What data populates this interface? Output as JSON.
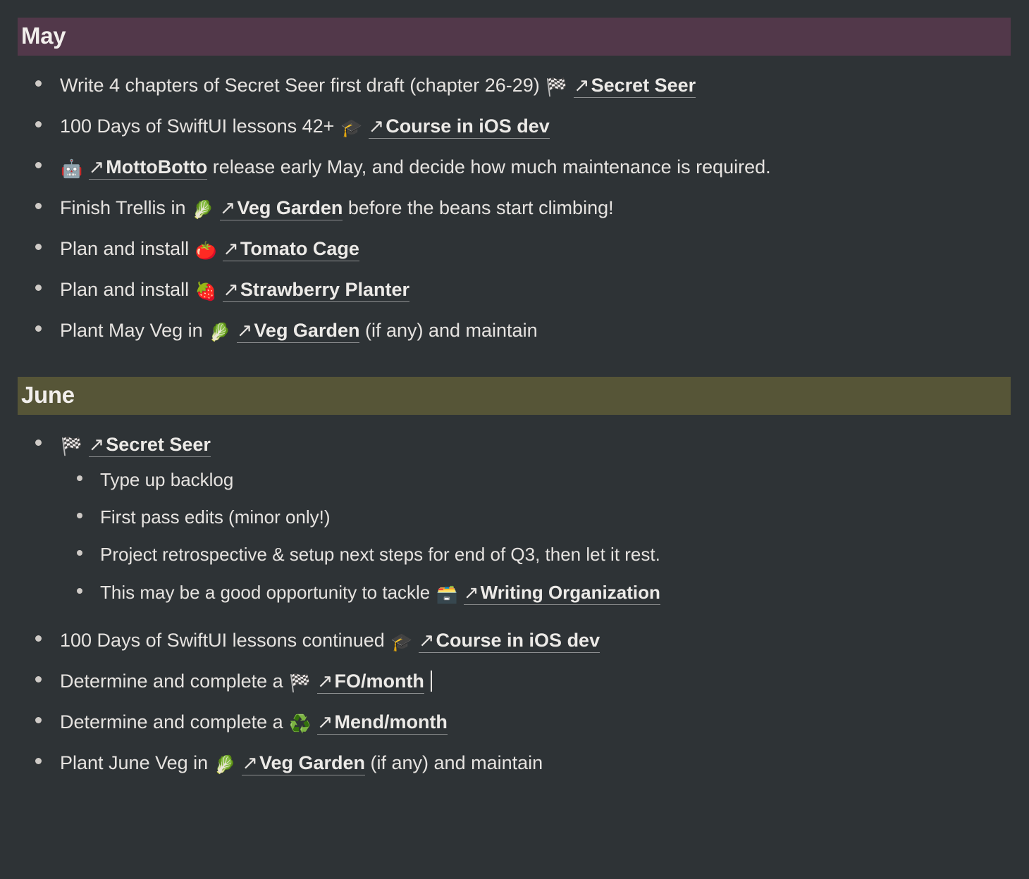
{
  "theme": {
    "background": "#2e3336",
    "text": "#e6e3e0",
    "link_underline": "#8d8f90",
    "may_header_bg": "#52384a",
    "june_header_bg": "#565537"
  },
  "icons": {
    "arrow_link": "↗",
    "checkered_flag": "🏁",
    "graduation_cap": "🎓",
    "robot": "🤖",
    "leafy_green": "🥬",
    "tomato": "🍅",
    "strawberry": "🍓",
    "card_file_box": "🗃️",
    "recycle": "♻️"
  },
  "sections": [
    {
      "id": "may",
      "title": "May",
      "items": [
        {
          "id": "may-secret-seer-chapters",
          "pre": "Write 4 chapters of Secret Seer first draft (chapter 26-29)",
          "emoji": "checkered_flag",
          "link": "Secret Seer",
          "post": ""
        },
        {
          "id": "may-swiftui-lessons",
          "pre": "100 Days of SwiftUI lessons 42+",
          "emoji": "graduation_cap",
          "link": "Course in iOS dev",
          "post": ""
        },
        {
          "id": "may-mottobotto",
          "pre": "",
          "emoji": "robot",
          "link": "MottoBotto",
          "post": "release early May, and decide how much maintenance is required."
        },
        {
          "id": "may-trellis",
          "pre": "Finish Trellis in",
          "emoji": "leafy_green",
          "link": "Veg Garden",
          "post": "before the beans start climbing!"
        },
        {
          "id": "may-tomato-cage",
          "pre": "Plan and install",
          "emoji": "tomato",
          "link": "Tomato Cage",
          "post": ""
        },
        {
          "id": "may-strawberry-planter",
          "pre": "Plan and install",
          "emoji": "strawberry",
          "link": "Strawberry Planter",
          "post": ""
        },
        {
          "id": "may-plant-veg",
          "pre": "Plant May Veg in",
          "emoji": "leafy_green",
          "link": "Veg Garden",
          "post": "(if any) and maintain"
        }
      ]
    },
    {
      "id": "june",
      "title": "June",
      "items": [
        {
          "id": "june-secret-seer",
          "pre": "",
          "emoji": "checkered_flag",
          "link": "Secret Seer",
          "post": "",
          "children": [
            {
              "id": "june-type-up-backlog",
              "pre": "Type up backlog",
              "emoji": "",
              "link": "",
              "post": ""
            },
            {
              "id": "june-first-pass-edits",
              "pre": "First pass edits (minor only!)",
              "emoji": "",
              "link": "",
              "post": ""
            },
            {
              "id": "june-retrospective",
              "pre": "Project retrospective & setup next steps for end of Q3, then let it rest.",
              "emoji": "",
              "link": "",
              "post": ""
            },
            {
              "id": "june-writing-organization",
              "pre": "This may be a good opportunity to tackle",
              "emoji": "card_file_box",
              "link": "Writing Organization",
              "post": ""
            }
          ]
        },
        {
          "id": "june-swiftui-lessons",
          "pre": "100 Days of SwiftUI lessons continued",
          "emoji": "graduation_cap",
          "link": "Course in iOS dev",
          "post": ""
        },
        {
          "id": "june-fo-month",
          "pre": "Determine and complete a",
          "emoji": "checkered_flag",
          "link": "FO/month",
          "post": "",
          "caret": true
        },
        {
          "id": "june-mend-month",
          "pre": "Determine and complete a",
          "emoji": "recycle",
          "link": "Mend/month",
          "post": ""
        },
        {
          "id": "june-plant-veg",
          "pre": "Plant June Veg in",
          "emoji": "leafy_green",
          "link": "Veg Garden",
          "post": "(if any) and maintain"
        }
      ]
    }
  ]
}
